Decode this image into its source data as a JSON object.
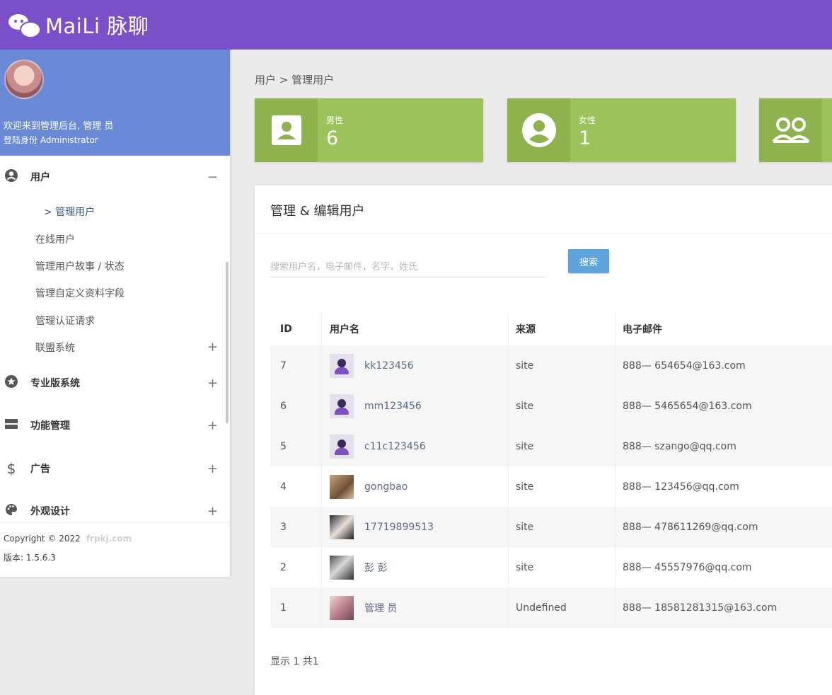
{
  "header": {
    "brand": "MaiLi 脉聊",
    "logo_icon": "wechat-icon"
  },
  "sidebar": {
    "welcome": "欢迎来到管理后台, 管理 员",
    "role": "登陆身份 Administrator",
    "menu": [
      {
        "label": "用户",
        "icon": "user-circle-icon",
        "toggle": "−"
      },
      {
        "label": "专业版系统",
        "icon": "star-icon",
        "toggle": "+"
      },
      {
        "label": "功能管理",
        "icon": "server-icon",
        "toggle": "+"
      },
      {
        "label": "广告",
        "icon": "dollar-icon",
        "toggle": "+"
      },
      {
        "label": "外观设计",
        "icon": "palette-icon",
        "toggle": "+"
      }
    ],
    "submenu": [
      {
        "label": "> 管理用户"
      },
      {
        "label": "在线用户"
      },
      {
        "label": "管理用户故事 / 状态"
      },
      {
        "label": "管理自定义资料字段"
      },
      {
        "label": "管理认证请求"
      },
      {
        "label": "联盟系统",
        "toggle": "+"
      }
    ],
    "copyright": "Copyright © 2022",
    "watermark": "frpkj.com",
    "version": "版本: 1.5.6.3"
  },
  "breadcrumb": "用户 > 管理用户",
  "stats": [
    {
      "label": "男性",
      "value": "6",
      "icon": "contact-card-icon"
    },
    {
      "label": "女性",
      "value": "1",
      "icon": "account-circle-icon"
    },
    {
      "label": "",
      "value": "",
      "icon": "group-icon"
    }
  ],
  "panel": {
    "title": "管理 & 编辑用户",
    "search_placeholder": "搜索用户名，电子邮件，名字，姓氏",
    "search_button": "搜索",
    "columns": [
      "ID",
      "用户名",
      "来源",
      "电子邮件"
    ],
    "rows": [
      {
        "id": "7",
        "username": "kk123456",
        "source": "site",
        "email": "888— 654654@163.com"
      },
      {
        "id": "6",
        "username": "mm123456",
        "source": "site",
        "email": "888— 5465654@163.com"
      },
      {
        "id": "5",
        "username": "c11c123456",
        "source": "site",
        "email": "888— szango@qq.com"
      },
      {
        "id": "4",
        "username": "gongbao",
        "source": "site",
        "email": "888— 123456@qq.com"
      },
      {
        "id": "3",
        "username": "17719899513",
        "source": "site",
        "email": "888— 478611269@qq.com"
      },
      {
        "id": "2",
        "username": "彭 彭",
        "source": "site",
        "email": "888— 45557976@qq.com"
      },
      {
        "id": "1",
        "username": "管理 员",
        "source": "Undefined",
        "email": "888— 18581281315@163.com"
      }
    ],
    "footer": "显示 1 共1"
  }
}
